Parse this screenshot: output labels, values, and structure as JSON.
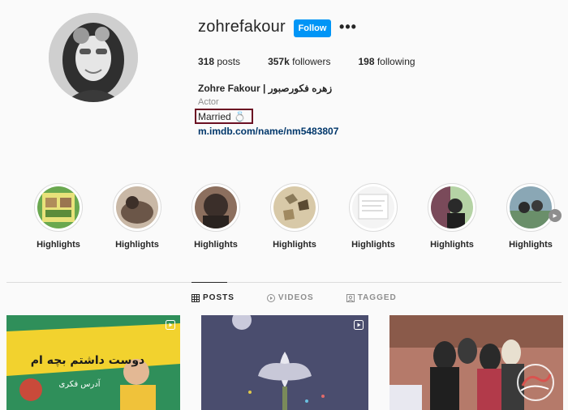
{
  "profile": {
    "username": "zohrefakour",
    "follow_label": "Follow",
    "more_label": "•••",
    "stats": {
      "posts_count": "318",
      "posts_label": "posts",
      "followers_count": "357k",
      "followers_label": "followers",
      "following_count": "198",
      "following_label": "following"
    },
    "full_name": "Zohre Fakour | زهره فکورصبور",
    "category": "Actor",
    "bio": "Married 💍",
    "link": "m.imdb.com/name/nm5483807"
  },
  "highlights": [
    {
      "label": "Highlights",
      "color_a": "#6aa84f",
      "color_b": "#e8e27a"
    },
    {
      "label": "Highlights",
      "color_a": "#6b5648",
      "color_b": "#c9b8a6"
    },
    {
      "label": "Highlights",
      "color_a": "#3b2f2a",
      "color_b": "#8c6f5e"
    },
    {
      "label": "Highlights",
      "color_a": "#8a7a5a",
      "color_b": "#d8c9a8"
    },
    {
      "label": "Highlights",
      "color_a": "#dcdcdc",
      "color_b": "#f4f4f4"
    },
    {
      "label": "Highlights",
      "color_a": "#7a4a5a",
      "color_b": "#b5d3a5"
    },
    {
      "label": "Highlights",
      "color_a": "#8aa7b5",
      "color_b": "#6a8f6a"
    }
  ],
  "tabs": [
    {
      "label": "POSTS",
      "icon": "grid-icon"
    },
    {
      "label": "VIDEOS",
      "icon": "play-circle-icon"
    },
    {
      "label": "TAGGED",
      "icon": "tag-icon"
    }
  ],
  "posts": [
    {
      "kind": "reel",
      "text": "دوست داشتم بچه ام",
      "subtext": "آدرس فکری",
      "bg": "#2f8f5a",
      "accent": "#f2d22e"
    },
    {
      "kind": "reel",
      "bg": "#4a4d6e",
      "accent": "#d8d8e8"
    },
    {
      "kind": "photo",
      "bg": "#b57a6a",
      "accent": "#2a2a2a"
    }
  ],
  "watermark": "آوینی"
}
